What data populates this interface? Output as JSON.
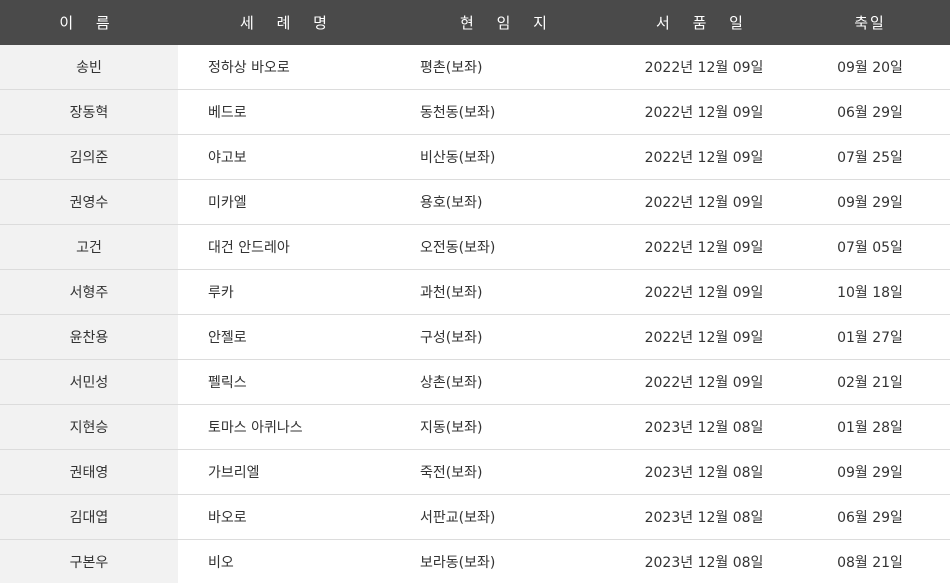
{
  "headers": {
    "name": "이 름",
    "baptism": "세 례 명",
    "parish": "현 임 지",
    "ordination": "서 품 일",
    "feast": "축일"
  },
  "rows": [
    {
      "name": "송빈",
      "baptism": "정하상 바오로",
      "parish": "평촌(보좌)",
      "ordination": "2022년 12월 09일",
      "feast": "09월 20일"
    },
    {
      "name": "장동혁",
      "baptism": "베드로",
      "parish": "동천동(보좌)",
      "ordination": "2022년 12월 09일",
      "feast": "06월 29일"
    },
    {
      "name": "김의준",
      "baptism": "야고보",
      "parish": "비산동(보좌)",
      "ordination": "2022년 12월 09일",
      "feast": "07월 25일"
    },
    {
      "name": "권영수",
      "baptism": "미카엘",
      "parish": "용호(보좌)",
      "ordination": "2022년 12월 09일",
      "feast": "09월 29일"
    },
    {
      "name": "고건",
      "baptism": "대건 안드레아",
      "parish": "오전동(보좌)",
      "ordination": "2022년 12월 09일",
      "feast": "07월 05일"
    },
    {
      "name": "서형주",
      "baptism": "루카",
      "parish": "과천(보좌)",
      "ordination": "2022년 12월 09일",
      "feast": "10월 18일"
    },
    {
      "name": "윤찬용",
      "baptism": "안젤로",
      "parish": "구성(보좌)",
      "ordination": "2022년 12월 09일",
      "feast": "01월 27일"
    },
    {
      "name": "서민성",
      "baptism": "펠릭스",
      "parish": "상촌(보좌)",
      "ordination": "2022년 12월 09일",
      "feast": "02월 21일"
    },
    {
      "name": "지현승",
      "baptism": "토마스 아퀴나스",
      "parish": "지동(보좌)",
      "ordination": "2023년 12월 08일",
      "feast": "01월 28일"
    },
    {
      "name": "권태영",
      "baptism": "가브리엘",
      "parish": "죽전(보좌)",
      "ordination": "2023년 12월 08일",
      "feast": "09월 29일"
    },
    {
      "name": "김대엽",
      "baptism": "바오로",
      "parish": "서판교(보좌)",
      "ordination": "2023년 12월 08일",
      "feast": "06월 29일"
    },
    {
      "name": "구본우",
      "baptism": "비오",
      "parish": "보라동(보좌)",
      "ordination": "2023년 12월 08일",
      "feast": "08월 21일"
    }
  ]
}
